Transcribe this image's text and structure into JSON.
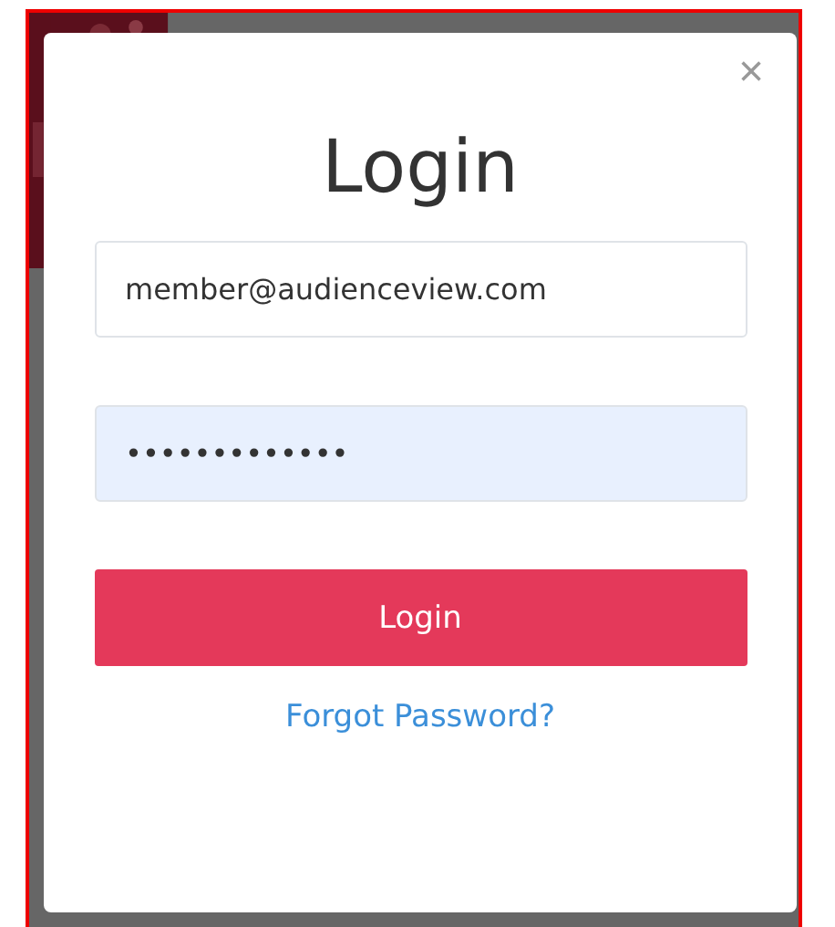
{
  "dialog": {
    "title": "Login",
    "close": "×",
    "email": {
      "value": "member@audienceview.com"
    },
    "password": {
      "value": "•••••••••••••",
      "autofilled": true
    },
    "submit": "Login",
    "forgot_link": "Forgot Password?"
  }
}
